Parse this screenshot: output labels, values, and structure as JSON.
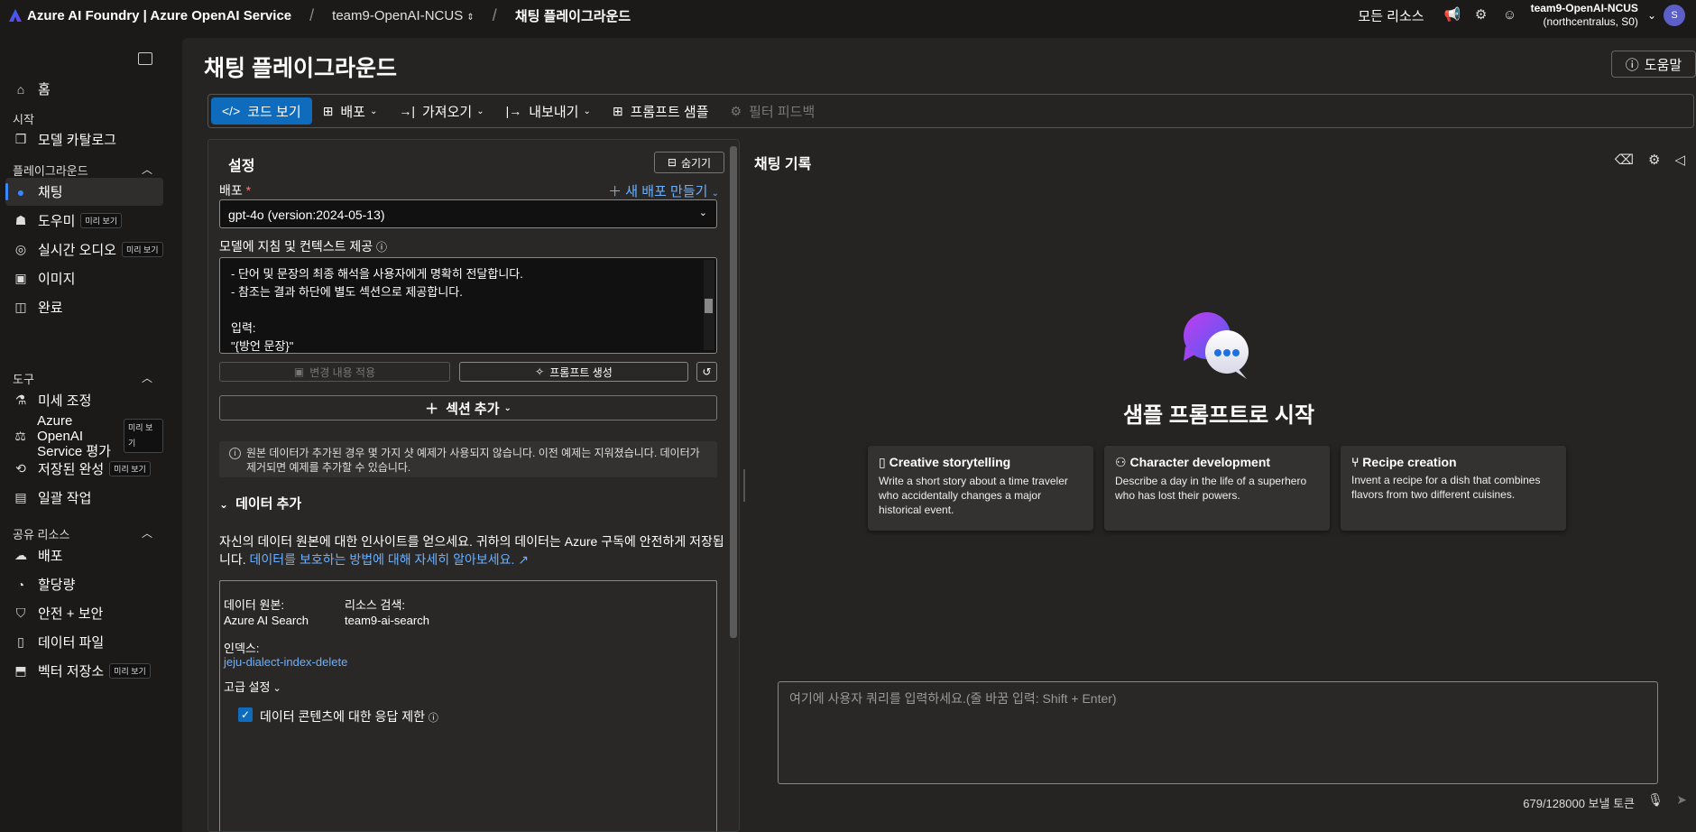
{
  "topbar": {
    "app": "Azure AI Foundry | Azure OpenAI Service",
    "project": "team9-OpenAI-NCUS",
    "page": "채팅 플레이그라운드",
    "all_resources": "모든 리소스",
    "account_name": "team9-OpenAI-NCUS",
    "account_region": "(northcentralus, S0)",
    "avatar": "S"
  },
  "sidebar": {
    "home": "홈",
    "sec_start": "시작",
    "model_catalog": "모델 카탈로그",
    "sec_playground": "플레이그라운드",
    "chat": "채팅",
    "assistants": "도우미",
    "realtime_audio": "실시간 오디오",
    "images": "이미지",
    "completions": "완료",
    "sec_tools": "도구",
    "finetune": "미세 조정",
    "eval_1": "Azure OpenAI",
    "eval_2": "Service 평가",
    "stored_completions": "저장된 완성",
    "batch": "일괄 작업",
    "sec_shared": "공유 리소스",
    "deployments": "배포",
    "quota": "할당량",
    "safety": "안전 + 보안",
    "data_files": "데이터 파일",
    "vector_stores": "벡터 저장소",
    "preview": "미리 보기"
  },
  "main": {
    "title": "채팅 플레이그라운드",
    "help": "도움말"
  },
  "toolbar": {
    "view_code": "코드 보기",
    "deploy": "배포",
    "import": "가져오기",
    "export": "내보내기",
    "prompt_samples": "프롬프트 샘플",
    "filter_feedback": "필터 피드백"
  },
  "settings": {
    "title": "설정",
    "hide": "숨기기",
    "deploy_label": "배포",
    "new_deploy": "새 배포 만들기",
    "deployment_value": "gpt-4o (version:2024-05-13)",
    "instructions_label": "모델에 지침 및 컨텍스트 제공",
    "instr_line1": "- 단어 및 문장의 최종 해석을 사용자에게 명확히 전달합니다.",
    "instr_line2": "- 참조는 결과 하단에 별도 섹션으로 제공합니다.",
    "instr_line3": "입력:",
    "instr_line4": "\"{방언 문장}\"",
    "apply_changes": "변경 내용 적용",
    "generate_prompt": "프롬프트 생성",
    "add_section": "섹션 추가",
    "notice": "원본 데이터가 추가된 경우 몇 가지 샷 예제가 사용되지 않습니다. 이전 예제는 지워졌습니다. 데이터가 제거되면 예제를 추가할 수 있습니다.",
    "add_data": "데이터 추가",
    "data_desc": "자신의 데이터 원본에 대한 인사이트를 얻으세요. 귀하의 데이터는 Azure 구독에 안전하게 저장됩니다.",
    "data_link": "데이터를 보호하는 방법에 대해 자세히 알아보세요.",
    "data_source_label": "데이터 원본:",
    "data_source_value": "Azure AI Search",
    "resource_label": "리소스 검색:",
    "resource_value": "team9-ai-search",
    "index_label": "인덱스:",
    "index_value": "jeju-dialect-index-delete",
    "advanced": "고급 설정",
    "limit_label": "데이터 콘텐츠에 대한 응답 제한"
  },
  "chat": {
    "title": "채팅 기록",
    "start": "샘플 프롬프트로 시작",
    "cards": [
      {
        "title": "Creative storytelling",
        "desc": "Write a short story about a time traveler who accidentally changes a major historical event."
      },
      {
        "title": "Character development",
        "desc": "Describe a day in the life of a superhero who has lost their powers."
      },
      {
        "title": "Recipe creation",
        "desc": "Invent a recipe for a dish that combines flavors from two different cuisines."
      }
    ],
    "input_placeholder": "여기에 사용자 쿼리를 입력하세요.(줄 바꿈 입력: Shift + Enter)",
    "tokens": "679/128000 보낼 토큰"
  }
}
